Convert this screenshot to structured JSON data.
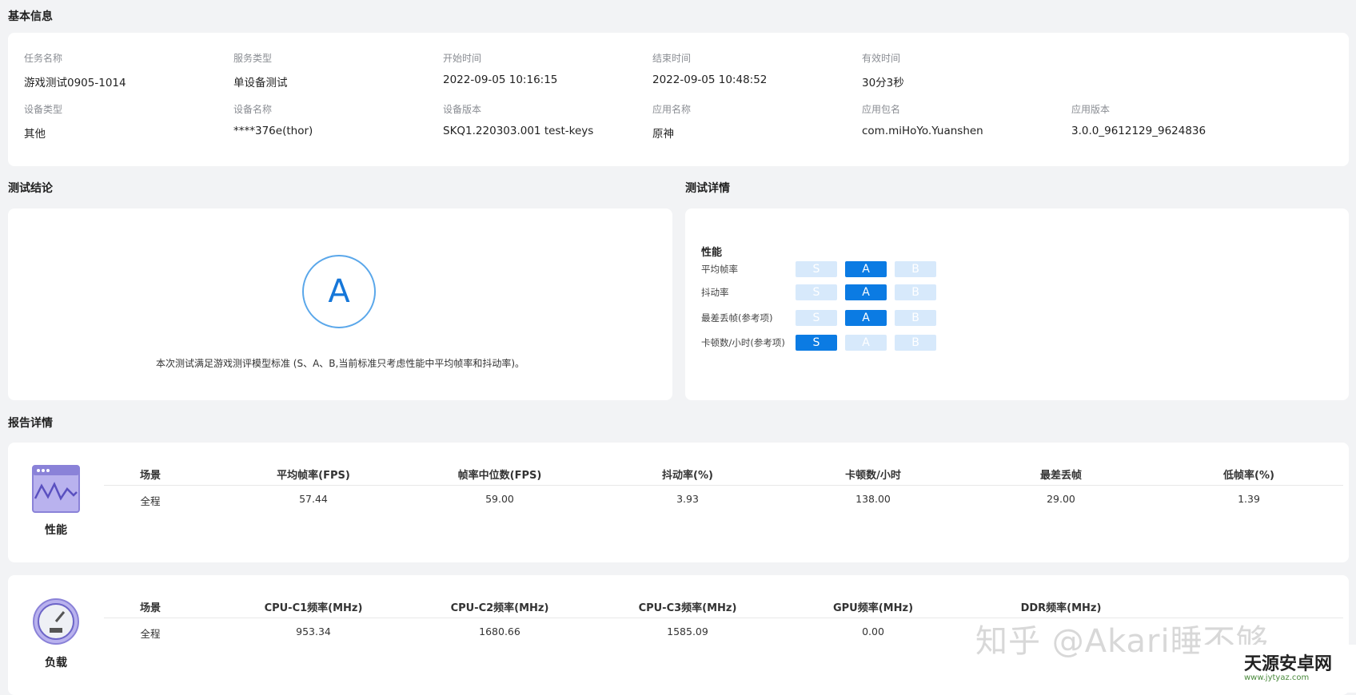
{
  "sections": {
    "basic_info": "基本信息",
    "conclusion": "测试结论",
    "details": "测试详情",
    "report": "报告详情"
  },
  "basic_info": {
    "row1": [
      {
        "label": "任务名称",
        "value": "游戏测试0905-1014"
      },
      {
        "label": "服务类型",
        "value": "单设备测试"
      },
      {
        "label": "开始时间",
        "value": "2022-09-05 10:16:15"
      },
      {
        "label": "结束时间",
        "value": "2022-09-05 10:48:52"
      },
      {
        "label": "有效时间",
        "value": "30分3秒"
      }
    ],
    "row2": [
      {
        "label": "设备类型",
        "value": "其他"
      },
      {
        "label": "设备名称",
        "value": "****376e(thor)"
      },
      {
        "label": "设备版本",
        "value": "SKQ1.220303.001 test-keys"
      },
      {
        "label": "应用名称",
        "value": "原神"
      },
      {
        "label": "应用包名",
        "value": "com.miHoYo.Yuanshen"
      },
      {
        "label": "应用版本",
        "value": "3.0.0_9612129_9624836"
      }
    ]
  },
  "conclusion": {
    "grade": "A",
    "description": "本次测试满足游戏测评模型标准 (S、A、B,当前标准只考虑性能中平均帧率和抖动率)。"
  },
  "details": {
    "heading": "性能",
    "grades": [
      "S",
      "A",
      "B"
    ],
    "rows": [
      {
        "label": "平均帧率",
        "selected": "A"
      },
      {
        "label": "抖动率",
        "selected": "A"
      },
      {
        "label": "最差丢帧(参考项)",
        "selected": "A"
      },
      {
        "label": "卡顿数/小时(参考项)",
        "selected": "S"
      }
    ]
  },
  "report": {
    "performance": {
      "label": "性能",
      "headers": [
        "场景",
        "平均帧率(FPS)",
        "帧率中位数(FPS)",
        "抖动率(%)",
        "卡顿数/小时",
        "最差丢帧",
        "低帧率(%)"
      ],
      "rows": [
        [
          "全程",
          "57.44",
          "59.00",
          "3.93",
          "138.00",
          "29.00",
          "1.39"
        ]
      ]
    },
    "load": {
      "label": "负载",
      "headers": [
        "场景",
        "CPU-C1频率(MHz)",
        "CPU-C2频率(MHz)",
        "CPU-C3频率(MHz)",
        "GPU频率(MHz)",
        "DDR频率(MHz)"
      ],
      "rows": [
        [
          "全程",
          "953.34",
          "1680.66",
          "1585.09",
          "0.00",
          ""
        ]
      ]
    }
  },
  "watermark": "知乎 @Akari睡不够",
  "logo": {
    "name": "天源安卓网",
    "url": "www.jytyaz.com"
  },
  "colors": {
    "accent": "#0b7be3",
    "grade_light": "#d7e9fb",
    "background": "#f2f3f5"
  }
}
